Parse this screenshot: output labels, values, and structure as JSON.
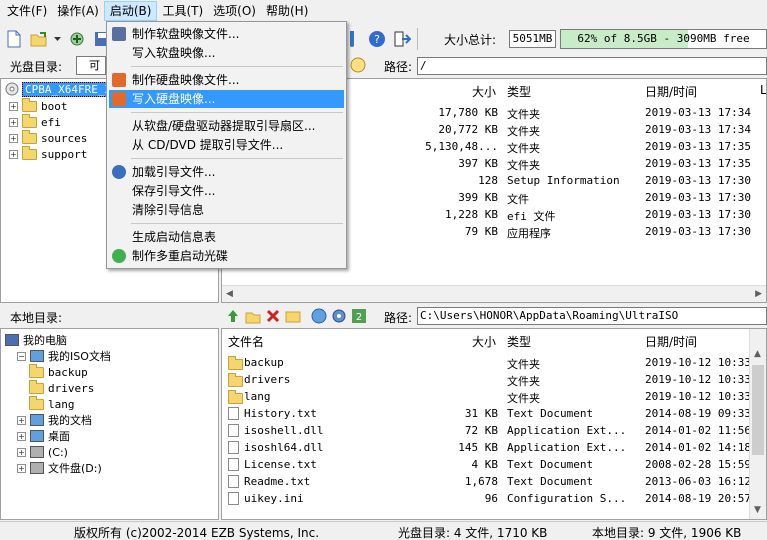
{
  "menubar": {
    "items": [
      "文件(F)",
      "操作(A)",
      "启动(B)",
      "工具(T)",
      "选项(O)",
      "帮助(H)"
    ],
    "active_index": 2
  },
  "toolbar": {
    "total_size_label": "大小总计:",
    "total_size_value": "5051MB",
    "capacity_text": "62% of 8.5GB - 3090MB free",
    "capacity_percent": 62,
    "icons": [
      "new-icon",
      "open-icon",
      "dropdown-arrow-icon",
      "extract-icon",
      "save-icon",
      "mount-icon",
      "help-icon",
      "exit-icon"
    ]
  },
  "boot_menu": {
    "items": [
      {
        "label": "制作软盘映像文件...",
        "icon": "floppy-icon",
        "highlighted": false
      },
      {
        "label": "写入软盘映像...",
        "icon": "",
        "highlighted": false
      },
      {
        "label": "制作硬盘映像文件...",
        "icon": "shield-icon",
        "highlighted": false
      },
      {
        "label": "写入硬盘映像...",
        "icon": "shield-icon",
        "highlighted": true
      },
      {
        "label": "从软盘/硬盘驱动器提取引导扇区...",
        "icon": "",
        "highlighted": false
      },
      {
        "label": "从 CD/DVD 提取引导文件...",
        "icon": "",
        "highlighted": false
      },
      {
        "label": "加载引导文件...",
        "icon": "gear-icon",
        "highlighted": false
      },
      {
        "label": "保存引导文件...",
        "icon": "",
        "highlighted": false
      },
      {
        "label": "清除引导信息",
        "icon": "",
        "highlighted": false
      },
      {
        "label": "生成启动信息表",
        "icon": "",
        "highlighted": false
      },
      {
        "label": "制作多重启动光碟",
        "icon": "globe-icon",
        "highlighted": false
      }
    ]
  },
  "disc_pane": {
    "dir_label": "光盘目录:",
    "combo_value": "可",
    "path_label": "路径:",
    "path_value": "/",
    "root_node": "CPBA_X64FRE_ZH",
    "folders": [
      "boot",
      "efi",
      "sources",
      "support"
    ],
    "columns": {
      "size": "大小",
      "type": "类型",
      "date": "日期/时间",
      "extra": "L"
    },
    "files": [
      {
        "size": "17,780 KB",
        "type": "文件夹",
        "date": "2019-03-13 17:34"
      },
      {
        "size": "20,772 KB",
        "type": "文件夹",
        "date": "2019-03-13 17:34"
      },
      {
        "size": "5,130,48...",
        "type": "文件夹",
        "date": "2019-03-13 17:35"
      },
      {
        "size": "397 KB",
        "type": "文件夹",
        "date": "2019-03-13 17:35"
      },
      {
        "size": "128",
        "type": "Setup Information",
        "date": "2019-03-13 17:30"
      },
      {
        "size": "399 KB",
        "type": "文件",
        "date": "2019-03-13 17:30"
      },
      {
        "size": "1,228 KB",
        "type": "efi 文件",
        "date": "2019-03-13 17:30"
      },
      {
        "size": "79 KB",
        "type": "应用程序",
        "date": "2019-03-13 17:30"
      }
    ]
  },
  "local_pane": {
    "dir_label": "本地目录:",
    "path_label": "路径:",
    "path_value": "C:\\Users\\HONOR\\AppData\\Roaming\\UltraISO",
    "tree": [
      {
        "label": "我的电脑",
        "level": 0
      },
      {
        "label": "我的ISO文档",
        "level": 1
      },
      {
        "label": "backup",
        "level": 2
      },
      {
        "label": "drivers",
        "level": 2
      },
      {
        "label": "lang",
        "level": 2
      },
      {
        "label": "我的文档",
        "level": 1
      },
      {
        "label": "桌面",
        "level": 1
      },
      {
        "label": "(C:)",
        "level": 1
      },
      {
        "label": "文件盘(D:)",
        "level": 1
      }
    ],
    "columns": {
      "name": "文件名",
      "size": "大小",
      "type": "类型",
      "date": "日期/时间"
    },
    "files": [
      {
        "name": "backup",
        "size": "",
        "type": "文件夹",
        "date": "2019-10-12 10:33",
        "kind": "folder"
      },
      {
        "name": "drivers",
        "size": "",
        "type": "文件夹",
        "date": "2019-10-12 10:33",
        "kind": "folder"
      },
      {
        "name": "lang",
        "size": "",
        "type": "文件夹",
        "date": "2019-10-12 10:33",
        "kind": "folder"
      },
      {
        "name": "History.txt",
        "size": "31 KB",
        "type": "Text Document",
        "date": "2014-08-19 09:33",
        "kind": "file"
      },
      {
        "name": "isoshell.dll",
        "size": "72 KB",
        "type": "Application Ext...",
        "date": "2014-01-02 11:56",
        "kind": "file"
      },
      {
        "name": "isoshl64.dll",
        "size": "145 KB",
        "type": "Application Ext...",
        "date": "2014-01-02 14:18",
        "kind": "file"
      },
      {
        "name": "License.txt",
        "size": "4 KB",
        "type": "Text Document",
        "date": "2008-02-28 15:59",
        "kind": "file"
      },
      {
        "name": "Readme.txt",
        "size": "1,678",
        "type": "Text Document",
        "date": "2013-06-03 16:12",
        "kind": "file"
      },
      {
        "name": "uikey.ini",
        "size": "96",
        "type": "Configuration S...",
        "date": "2014-08-19 20:57",
        "kind": "file"
      }
    ]
  },
  "statusbar": {
    "copyright": "版权所有 (c)2002-2014 EZB Systems, Inc.",
    "disc_info": "光盘目录: 4 文件, 1710 KB",
    "local_info": "本地目录: 9 文件, 1906 KB"
  }
}
